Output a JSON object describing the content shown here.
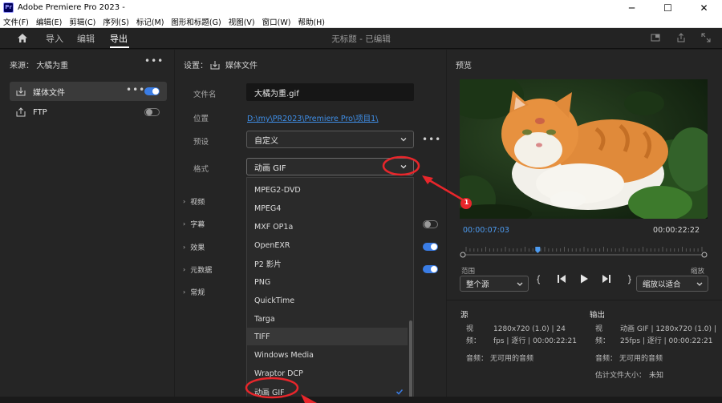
{
  "window": {
    "logo": "Pr",
    "title": "Adobe Premiere Pro 2023 -",
    "minimize": "─",
    "maximize": "☐",
    "close": "✕"
  },
  "menu": [
    "文件(F)",
    "编辑(E)",
    "剪辑(C)",
    "序列(S)",
    "标记(M)",
    "图形和标题(G)",
    "视图(V)",
    "窗口(W)",
    "帮助(H)"
  ],
  "header": {
    "tabs": [
      "导入",
      "编辑",
      "导出"
    ],
    "active_tab": "导出",
    "document_title": "无标题 - 已编辑"
  },
  "source_panel": {
    "source_label": "来源：",
    "source_name": "大橘为重",
    "destinations": [
      {
        "label": "媒体文件",
        "enabled": true
      },
      {
        "label": "FTP",
        "enabled": false
      }
    ]
  },
  "settings": {
    "header_label": "设置：",
    "destination": "媒体文件",
    "file_name_label": "文件名",
    "file_name": "大橘为重.gif",
    "location_label": "位置",
    "location": "D:\\my\\PR2023\\Premiere Pro\\项目1\\",
    "preset_label": "预设",
    "preset": "自定义",
    "format_label": "格式",
    "format": "动画 GIF",
    "sections": [
      "视频",
      "字幕",
      "效果",
      "元数据",
      "常规"
    ],
    "format_options": [
      "MPEG2-DVD",
      "MPEG4",
      "MXF OP1a",
      "OpenEXR",
      "P2 影片",
      "PNG",
      "QuickTime",
      "Targa",
      "TIFF",
      "Windows Media",
      "Wraptor DCP",
      "动画 GIF"
    ],
    "hovered_option": "TIFF",
    "selected_option": "动画 GIF"
  },
  "preview": {
    "title": "预览",
    "current_time": "00:00:07:03",
    "duration": "00:00:22:22",
    "playhead_fraction": 0.31,
    "range_label": "范围",
    "range_value": "整个源",
    "scale_label": "缩放",
    "scale_value": "缩放以适合"
  },
  "summary": {
    "source_title": "源",
    "source_video_label": "视频：",
    "source_video": "1280x720 (1.0) | 24 fps | 逐行 | 00:00:22:21",
    "source_audio_label": "音频：",
    "source_audio": "无可用的音频",
    "output_title": "输出",
    "output_video_label": "视频：",
    "output_video": "动画 GIF | 1280x720 (1.0) | 25fps | 逐行 | 00:00:22:21",
    "output_audio_label": "音频：",
    "output_audio": "无可用的音频",
    "size_label": "估计文件大小：",
    "size_value": "未知"
  },
  "annotation": {
    "marker_number": "1",
    "color": "#e8262b"
  },
  "colors": {
    "accent_blue": "#3a7de6",
    "link_blue": "#3f8fe8",
    "panel_bg": "#252525"
  }
}
